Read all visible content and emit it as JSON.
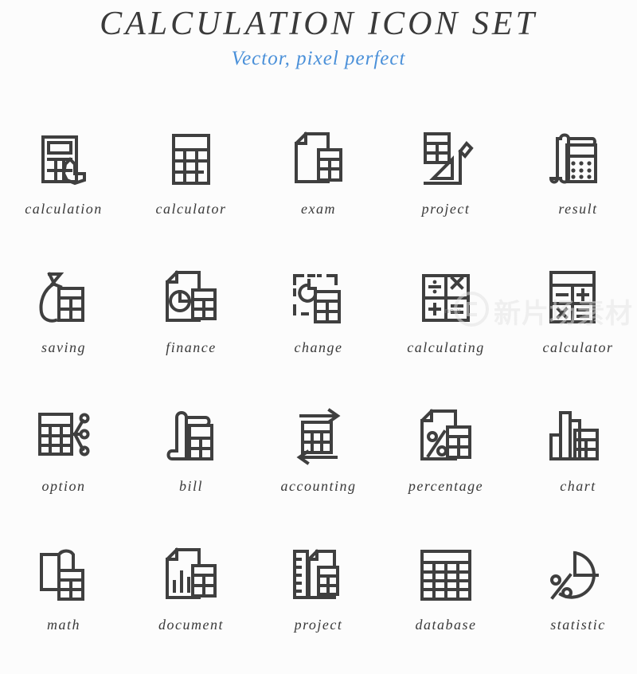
{
  "header": {
    "title": "CALCULATION ICON SET",
    "subtitle": "Vector, pixel perfect"
  },
  "colors": {
    "background": "#fcfcfc",
    "icon_stroke": "#3f3f3f",
    "title": "#3a3a3a",
    "subtitle": "#4a90d9",
    "label": "#3a3a3a",
    "watermark": "#e4e4e4"
  },
  "watermark": {
    "text": "新片场素材",
    "badge": "new"
  },
  "grid": {
    "columns": 5,
    "rows": 4
  },
  "icons": [
    {
      "label": "calculation",
      "icon": "calculator-with-hand-cursor-icon"
    },
    {
      "label": "calculator",
      "icon": "calculator-grid-icon"
    },
    {
      "label": "exam",
      "icon": "document-with-calculator-icon"
    },
    {
      "label": "project",
      "icon": "calculator-with-ruler-and-pencil-icon"
    },
    {
      "label": "result",
      "icon": "receipt-scroll-with-calculator-icon"
    },
    {
      "label": "saving",
      "icon": "money-bag-with-calculator-icon"
    },
    {
      "label": "finance",
      "icon": "document-pie-chart-with-calculator-icon"
    },
    {
      "label": "change",
      "icon": "dashed-frame-refresh-with-calculator-icon"
    },
    {
      "label": "calculating",
      "icon": "operators-keypad-icon"
    },
    {
      "label": "calculator",
      "icon": "calculator-operator-keys-icon"
    },
    {
      "label": "option",
      "icon": "calculator-with-nodes-icon"
    },
    {
      "label": "bill",
      "icon": "bill-scroll-with-calculator-icon"
    },
    {
      "label": "accounting",
      "icon": "calculator-with-exchange-arrows-icon"
    },
    {
      "label": "percentage",
      "icon": "document-percent-with-calculator-icon"
    },
    {
      "label": "chart",
      "icon": "bar-chart-with-calculator-icon"
    },
    {
      "label": "math",
      "icon": "open-book-with-calculator-icon"
    },
    {
      "label": "document",
      "icon": "document-bar-chart-with-calculator-icon"
    },
    {
      "label": "project",
      "icon": "ruler-document-with-calculator-icon"
    },
    {
      "label": "database",
      "icon": "table-grid-icon"
    },
    {
      "label": "statistic",
      "icon": "pie-chart-percent-icon"
    }
  ]
}
